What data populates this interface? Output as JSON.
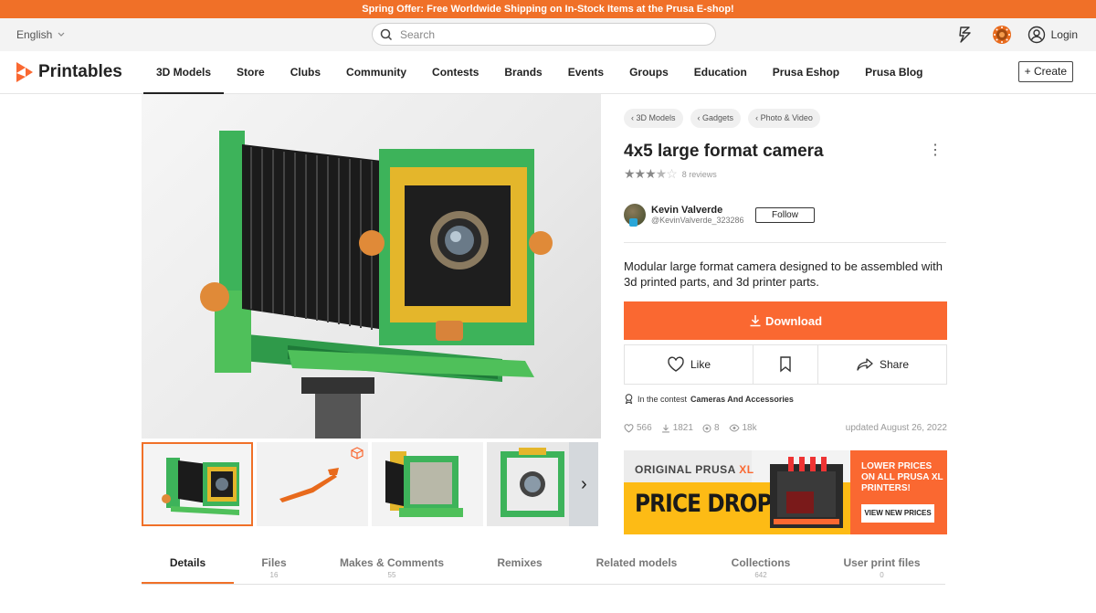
{
  "promo": {
    "lead": "Spring Offer:",
    "text": " Free Worldwide Shipping on In-Stock Items at the Prusa E-shop!"
  },
  "topbar": {
    "language": "English",
    "search_placeholder": "Search",
    "login": "Login"
  },
  "brand": {
    "name": "Printables",
    "accent": "#fa6831"
  },
  "nav": {
    "items": [
      "3D Models",
      "Store",
      "Clubs",
      "Community",
      "Contests",
      "Brands",
      "Events",
      "Groups",
      "Education",
      "Prusa Eshop",
      "Prusa Blog"
    ],
    "create": "+ Create"
  },
  "model": {
    "breadcrumbs": [
      "3D Models",
      "Gadgets",
      "Photo & Video"
    ],
    "title": "4x5 large format camera",
    "rating": 3.5,
    "reviews": "8 reviews",
    "author": {
      "name": "Kevin Valverde",
      "handle": "@KevinValverde_323286",
      "follow": "Follow"
    },
    "description": "Modular large format camera designed to be assembled with 3d printed parts, and 3d printer parts.",
    "download": "Download",
    "like": "Like",
    "share": "Share",
    "contest_prefix": "In the contest ",
    "contest_name": "Cameras And Accessories",
    "stats": {
      "likes": "566",
      "downloads": "1821",
      "makes": "8",
      "views": "18k"
    },
    "updated": "updated August 26, 2022"
  },
  "ad": {
    "headline_a": "ORIGINAL PRUSA ",
    "headline_b": "XL",
    "price": "PRICE DROP!",
    "side_text": "LOWER PRICES ON ALL PRUSA XL PRINTERS!",
    "button": "VIEW NEW PRICES"
  },
  "tabs": [
    {
      "label": "Details",
      "count": ""
    },
    {
      "label": "Files",
      "count": "16"
    },
    {
      "label": "Makes & Comments",
      "count": "55"
    },
    {
      "label": "Remixes",
      "count": ""
    },
    {
      "label": "Related models",
      "count": ""
    },
    {
      "label": "Collections",
      "count": "642"
    },
    {
      "label": "User print files",
      "count": "0"
    }
  ]
}
